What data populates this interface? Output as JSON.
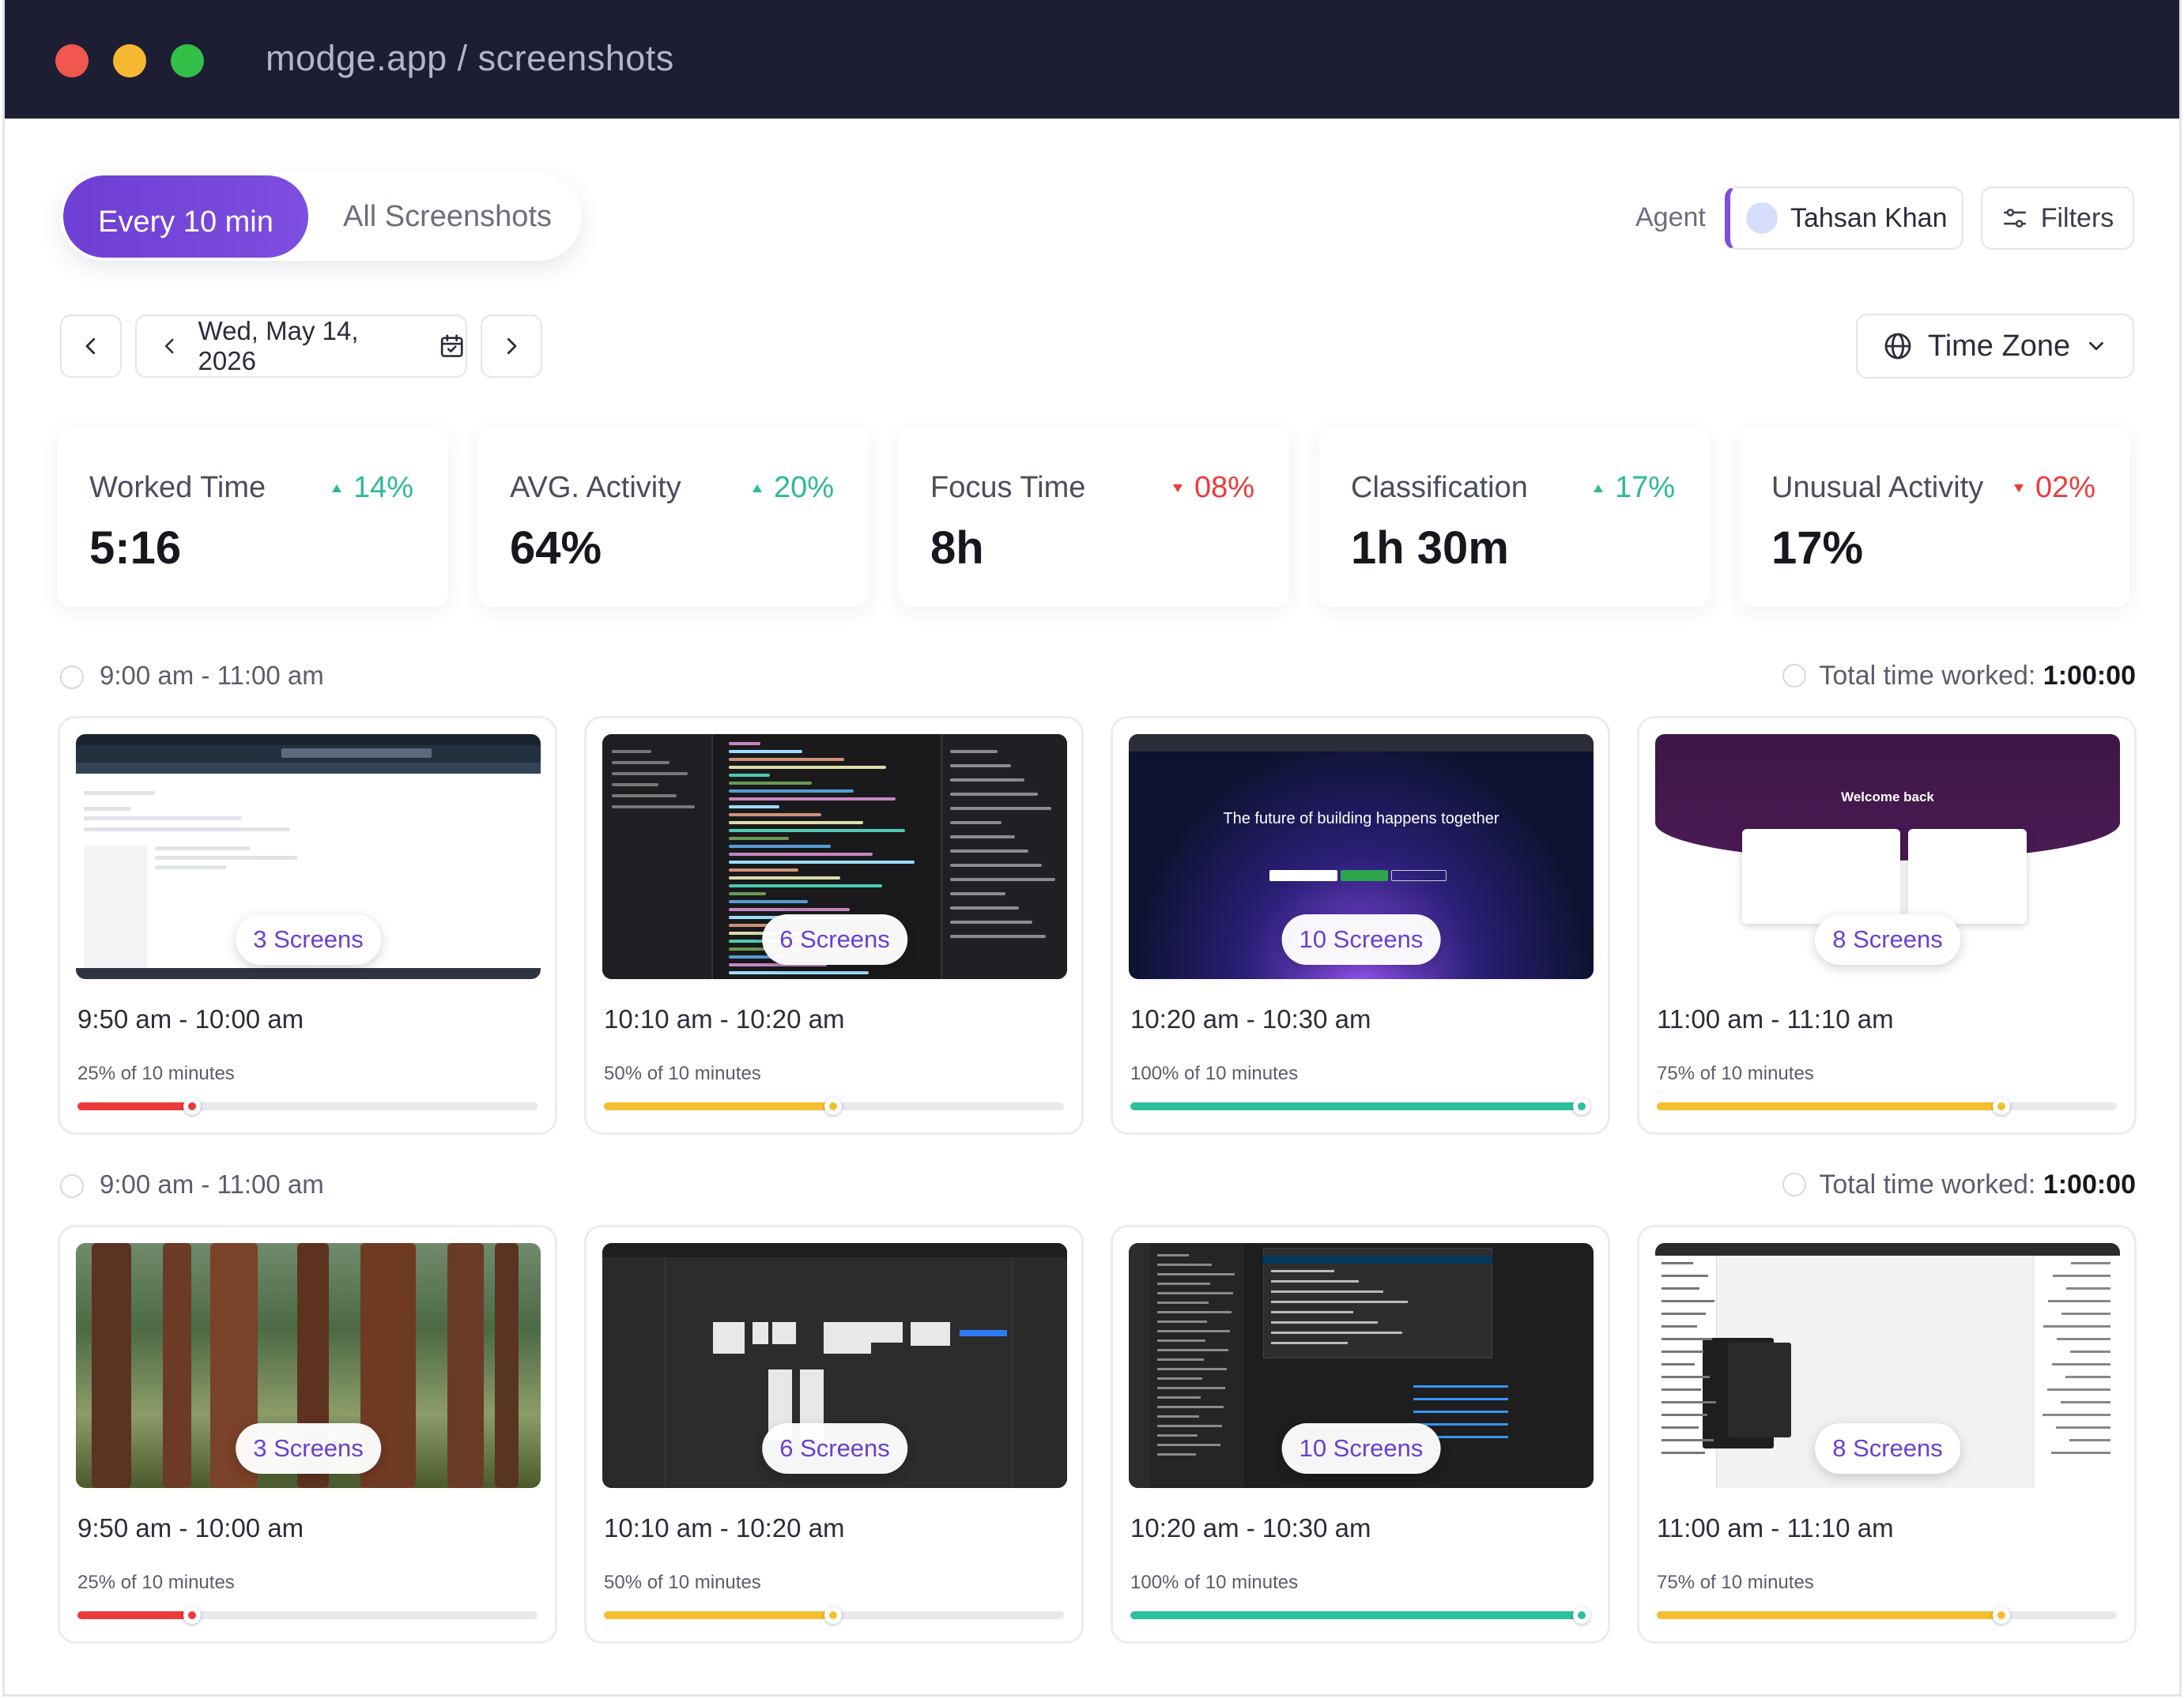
{
  "window": {
    "title": "modge.app / screenshots"
  },
  "view_toggle": {
    "active": "Every 10 min",
    "inactive": "All Screenshots"
  },
  "agent": {
    "label": "Agent",
    "name": "Tahsan Khan"
  },
  "filters": {
    "label": "Filters"
  },
  "date_nav": {
    "date": "Wed, May 14, 2026"
  },
  "timezone": {
    "label": "Time Zone"
  },
  "stats": [
    {
      "label": "Worked Time",
      "value": "5:16",
      "change": "14%",
      "trend": "up"
    },
    {
      "label": "AVG. Activity",
      "value": "64%",
      "change": "20%",
      "trend": "up"
    },
    {
      "label": "Focus Time",
      "value": "8h",
      "change": "08%",
      "trend": "down"
    },
    {
      "label": "Classification",
      "value": "1h 30m",
      "change": "17%",
      "trend": "up"
    },
    {
      "label": "Unusual Activity",
      "value": "17%",
      "change": "02%",
      "trend": "down"
    }
  ],
  "colors": {
    "accent": "#7d4ee0",
    "up": "#2cb99b",
    "down": "#ec3a3a",
    "red": "#ec3a3a",
    "yellow": "#f5be2e",
    "green": "#2cc19e"
  },
  "sections": [
    {
      "range": "9:00 am - 11:00 am",
      "total_label": "Total time worked:",
      "total_value": "1:00:00",
      "cards": [
        {
          "screens": "3 Screens",
          "time": "9:50 am - 10:00 am",
          "activity": "25% of 10 minutes",
          "percent": 25,
          "color": "#ec3a3a"
        },
        {
          "screens": "6 Screens",
          "time": "10:10 am - 10:20 am",
          "activity": "50% of 10 minutes",
          "percent": 50,
          "color": "#f5be2e"
        },
        {
          "screens": "10 Screens",
          "time": "10:20 am - 10:30 am",
          "activity": "100% of 10 minutes",
          "percent": 100,
          "color": "#2cc19e"
        },
        {
          "screens": "8 Screens",
          "time": "11:00 am - 11:10 am",
          "activity": "75% of 10 minutes",
          "percent": 75,
          "color": "#f5be2e"
        }
      ]
    },
    {
      "range": "9:00 am - 11:00 am",
      "total_label": "Total time worked:",
      "total_value": "1:00:00",
      "cards": [
        {
          "screens": "3 Screens",
          "time": "9:50 am - 10:00 am",
          "activity": "25% of 10 minutes",
          "percent": 25,
          "color": "#ec3a3a"
        },
        {
          "screens": "6 Screens",
          "time": "10:10 am - 10:20 am",
          "activity": "50% of 10 minutes",
          "percent": 50,
          "color": "#f5be2e"
        },
        {
          "screens": "10 Screens",
          "time": "10:20 am - 10:30 am",
          "activity": "100% of 10 minutes",
          "percent": 100,
          "color": "#2cc19e"
        },
        {
          "screens": "8 Screens",
          "time": "11:00 am - 11:10 am",
          "activity": "75% of 10 minutes",
          "percent": 75,
          "color": "#f5be2e"
        }
      ]
    }
  ],
  "thumbnails": {
    "github_headline": "The future of building happens together",
    "purple_headline": "Welcome back"
  }
}
